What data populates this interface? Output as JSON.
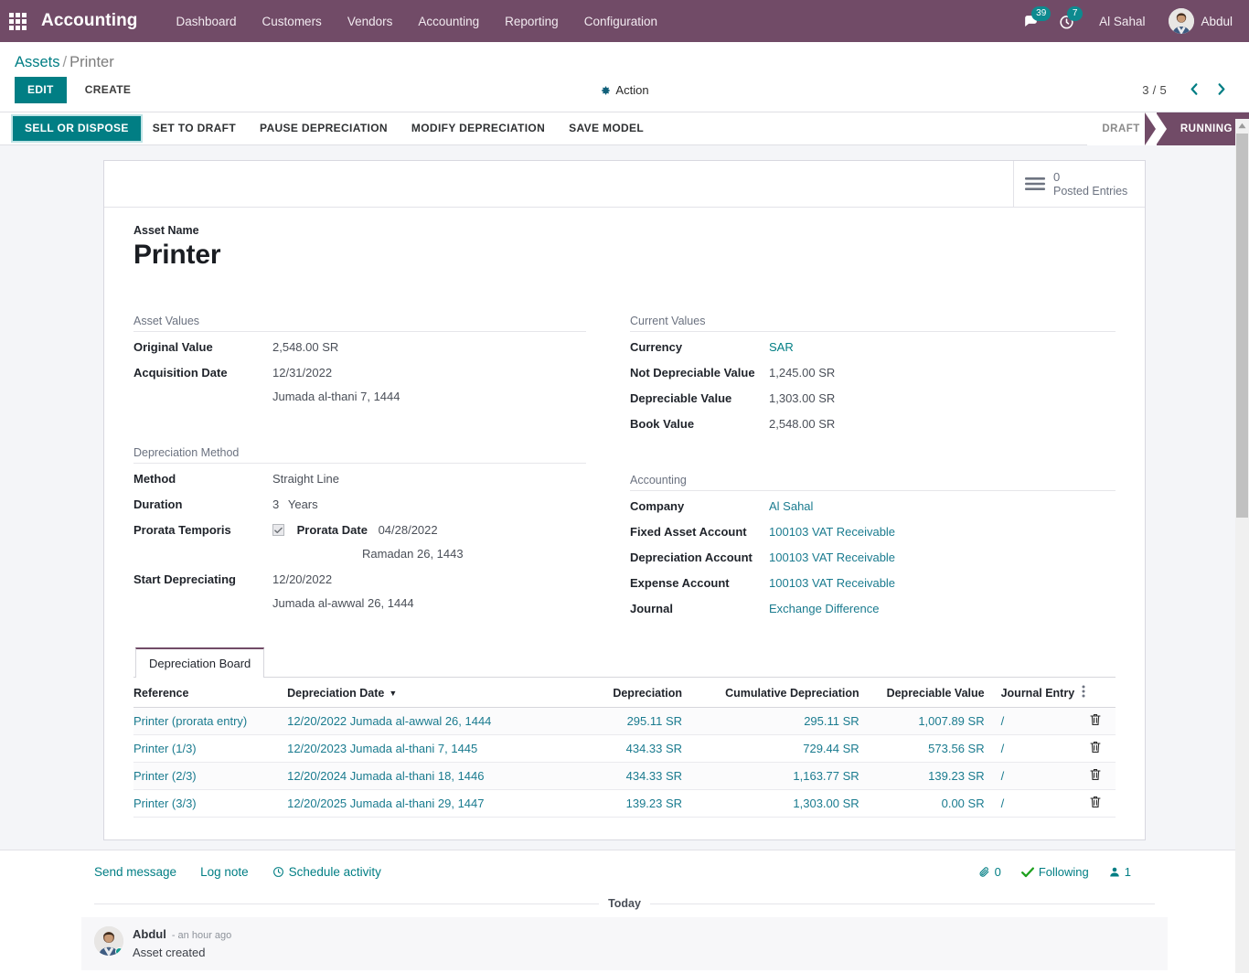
{
  "navbar": {
    "apps_icon": "apps-grid-icon",
    "brand": "Accounting",
    "menu": [
      "Dashboard",
      "Customers",
      "Vendors",
      "Accounting",
      "Reporting",
      "Configuration"
    ],
    "messages_icon": "chat-bubble-icon",
    "messages_count": "39",
    "activities_icon": "clock-icon",
    "activities_count": "7",
    "company": "Al Sahal",
    "user_avatar": "user-avatar",
    "user_name": "Abdul"
  },
  "control_panel": {
    "breadcrumb_root": "Assets",
    "breadcrumb_sep": "/",
    "breadcrumb_current": "Printer",
    "edit_label": "EDIT",
    "create_label": "CREATE",
    "action_icon": "gear-icon",
    "action_label": "Action",
    "pager_count": "3 / 5",
    "prev_icon": "chevron-left-icon",
    "next_icon": "chevron-right-icon"
  },
  "statusbar": {
    "buttons": [
      {
        "label": "SELL OR DISPOSE",
        "primary": true
      },
      {
        "label": "SET TO DRAFT",
        "primary": false
      },
      {
        "label": "PAUSE DEPRECIATION",
        "primary": false
      },
      {
        "label": "MODIFY DEPRECIATION",
        "primary": false
      },
      {
        "label": "SAVE MODEL",
        "primary": false
      }
    ],
    "states": [
      {
        "label": "DRAFT",
        "active": false
      },
      {
        "label": "RUNNING",
        "active": true
      }
    ]
  },
  "stat_button": {
    "icon": "list-lines-icon",
    "value": "0",
    "label": "Posted Entries"
  },
  "record": {
    "name_label": "Asset Name",
    "name_value": "Printer",
    "asset_values": {
      "title": "Asset Values",
      "rows": [
        {
          "label": "Original Value",
          "value": "2,548.00 SR",
          "sub": ""
        },
        {
          "label": "Acquisition Date",
          "value": "12/31/2022",
          "sub": "Jumada al-thani 7, 1444"
        }
      ]
    },
    "current_values": {
      "title": "Current Values",
      "rows": [
        {
          "label": "Currency",
          "value": "SAR",
          "link": true
        },
        {
          "label": "Not Depreciable Value",
          "value": "1,245.00 SR",
          "link": false
        },
        {
          "label": "Depreciable Value",
          "value": "1,303.00 SR",
          "link": false
        },
        {
          "label": "Book Value",
          "value": "2,548.00 SR",
          "link": false
        }
      ]
    },
    "depreciation_method": {
      "title": "Depreciation Method",
      "method_label": "Method",
      "method_value": "Straight Line",
      "duration_label": "Duration",
      "duration_value": "3",
      "duration_unit": "Years",
      "prorata_label": "Prorata Temporis",
      "prorata_checked": true,
      "prorata_date_label": "Prorata Date",
      "prorata_date_value": "04/28/2022",
      "prorata_date_hijri": "Ramadan 26, 1443",
      "start_label": "Start Depreciating",
      "start_value": "12/20/2022",
      "start_hijri": "Jumada al-awwal 26, 1444"
    },
    "accounting": {
      "title": "Accounting",
      "rows": [
        {
          "label": "Company",
          "value": "Al Sahal"
        },
        {
          "label": "Fixed Asset Account",
          "value": "100103 VAT Receivable"
        },
        {
          "label": "Depreciation Account",
          "value": "100103 VAT Receivable"
        },
        {
          "label": "Expense Account",
          "value": "100103 VAT Receivable"
        },
        {
          "label": "Journal",
          "value": "Exchange Difference"
        }
      ]
    }
  },
  "notebook": {
    "tabs": [
      {
        "label": "Depreciation Board",
        "active": true
      }
    ],
    "table": {
      "columns": [
        "Reference",
        "Depreciation Date",
        "Depreciation",
        "Cumulative Depreciation",
        "Depreciable Value",
        "Journal Entry"
      ],
      "sorted_column": "Depreciation Date",
      "sort_caret": "▼",
      "options_icon": "kebab-menu-icon",
      "delete_icon": "trash-icon",
      "rows": [
        {
          "reference": "Printer (prorata entry)",
          "date": "12/20/2022 Jumada al-awwal 26, 1444",
          "depreciation": "295.11 SR",
          "cumulative": "295.11 SR",
          "depreciable": "1,007.89 SR",
          "journal_entry": "/"
        },
        {
          "reference": "Printer (1/3)",
          "date": "12/20/2023 Jumada al-thani 7, 1445",
          "depreciation": "434.33 SR",
          "cumulative": "729.44 SR",
          "depreciable": "573.56 SR",
          "journal_entry": "/"
        },
        {
          "reference": "Printer (2/3)",
          "date": "12/20/2024 Jumada al-thani 18, 1446",
          "depreciation": "434.33 SR",
          "cumulative": "1,163.77 SR",
          "depreciable": "139.23 SR",
          "journal_entry": "/"
        },
        {
          "reference": "Printer (3/3)",
          "date": "12/20/2025 Jumada al-thani 29, 1447",
          "depreciation": "139.23 SR",
          "cumulative": "1,303.00 SR",
          "depreciable": "0.00 SR",
          "journal_entry": "/"
        }
      ]
    }
  },
  "chatter": {
    "send_message": "Send message",
    "log_note": "Log note",
    "schedule_activity": "Schedule activity",
    "schedule_icon": "clock-icon",
    "attachment_icon": "paperclip-icon",
    "attachment_count": "0",
    "following_icon": "check-icon",
    "following_label": "Following",
    "followers_icon": "user-icon",
    "followers_count": "1",
    "day_separator": "Today",
    "messages": [
      {
        "author": "Abdul",
        "time": "- an hour ago",
        "body": "Asset created"
      }
    ]
  }
}
